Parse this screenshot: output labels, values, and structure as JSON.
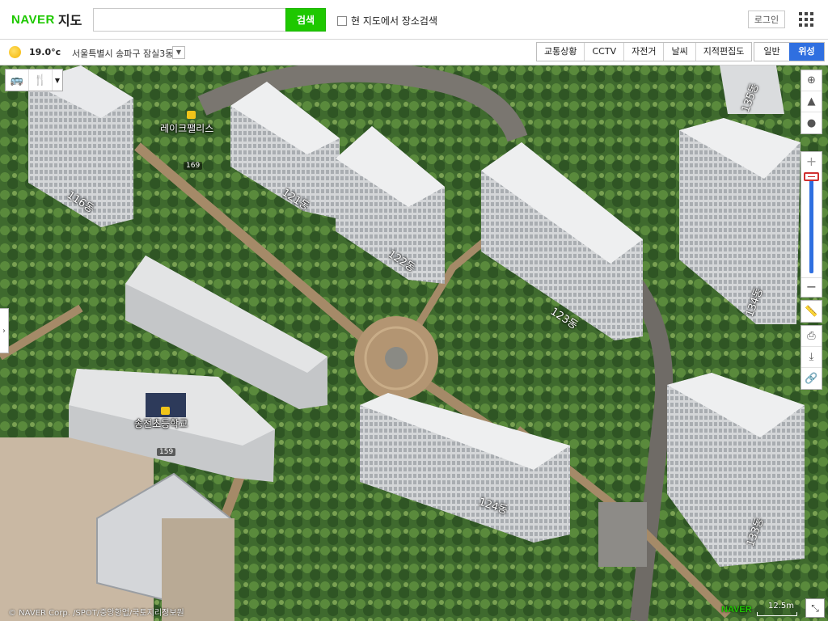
{
  "header": {
    "brand": "NAVER",
    "product": "지도",
    "search_placeholder": "",
    "search_button": "검색",
    "map_search_check_label": "현 지도에서 장소검색",
    "login_button": "로그인"
  },
  "subbar": {
    "temperature": "19.0°c",
    "location": "서울특별시 송파구 잠실3동",
    "layers": [
      "교통상황",
      "CCTV",
      "자전거",
      "날씨",
      "지적편집도"
    ],
    "map_types": [
      "일반",
      "위성"
    ],
    "active_map_type": "위성"
  },
  "map": {
    "pois": {
      "lake_palace": "레이크팰리스",
      "school": "송전초등학교"
    },
    "address_tags": {
      "a169": "169",
      "a159": "159"
    },
    "buildings": {
      "b116": "116동",
      "b121": "121동",
      "b122": "122동",
      "b123": "123동",
      "b124": "124동",
      "b133": "133동",
      "b134": "134동",
      "b135": "135동"
    },
    "scale": "12.5m",
    "copyright": "© NAVER Corp. /SPOT/중앙항업/국토지리정보원",
    "watermark": "NAVER"
  },
  "colors": {
    "brand_green": "#1ec800",
    "active_blue": "#2f6fe0"
  }
}
